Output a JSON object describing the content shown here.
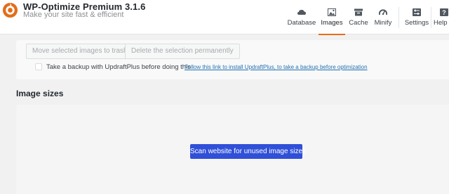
{
  "header": {
    "title": "WP-Optimize Premium 3.1.6",
    "tagline": "Make your site fast & efficient",
    "logo_icon": "wp-optimize-logo-icon",
    "accent_color": "#e36d1a"
  },
  "nav": {
    "items": [
      {
        "label": "Database",
        "icon": "database-icon",
        "active": false
      },
      {
        "label": "Images",
        "icon": "images-icon",
        "active": true
      },
      {
        "label": "Cache",
        "icon": "cache-icon",
        "active": false
      },
      {
        "label": "Minify",
        "icon": "minify-gauge-icon",
        "active": false
      },
      {
        "label": "Settings",
        "icon": "settings-icon",
        "active": false
      },
      {
        "label": "Help",
        "icon": "help-icon",
        "active": false
      }
    ]
  },
  "unused_images": {
    "move_button": "Move selected images to trash",
    "delete_button": "Delete the selection permanently",
    "backup_label": "Take a backup with UpdraftPlus before doing this",
    "backup_link": "Follow this link to install UpdraftPlus, to take a backup before optimization"
  },
  "image_sizes": {
    "title": "Image sizes",
    "scan_button": "Scan website for unused image sizes",
    "button_color": "#3050d8"
  }
}
